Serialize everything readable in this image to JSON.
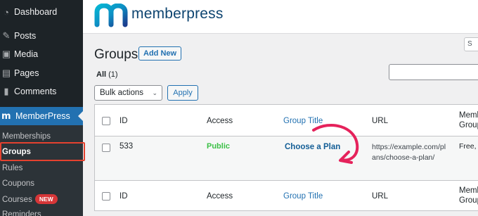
{
  "sidebar": {
    "items": [
      {
        "label": "Dashboard",
        "icon": "dashboard-icon"
      },
      {
        "label": "Posts",
        "icon": "pin-icon"
      },
      {
        "label": "Media",
        "icon": "media-icon"
      },
      {
        "label": "Pages",
        "icon": "pages-icon"
      },
      {
        "label": "Comments",
        "icon": "comment-icon"
      }
    ],
    "active": {
      "label": "MemberPress",
      "icon": "memberpress-icon"
    },
    "submenu": [
      {
        "label": "Memberships"
      },
      {
        "label": "Groups"
      },
      {
        "label": "Rules"
      },
      {
        "label": "Coupons"
      },
      {
        "label": "Courses",
        "badge": "NEW"
      },
      {
        "label": "Reminders"
      }
    ]
  },
  "header": {
    "logo_text": "memberpress",
    "screen_options_label": "S"
  },
  "page": {
    "title": "Groups",
    "add_new_label": "Add New",
    "filter_all_label": "All",
    "filter_all_count": "(1)",
    "bulk_actions_label": "Bulk actions",
    "apply_label": "Apply"
  },
  "table": {
    "columns": [
      "ID",
      "Access",
      "Group Title",
      "URL",
      "Memb Group"
    ],
    "column_line2": "Group",
    "column_line1": "Memb",
    "row": {
      "id": "533",
      "access": "Public",
      "title": "Choose a Plan",
      "url_line1": "https://example.com/pl",
      "url_line2": "ans/choose-a-plan/",
      "memberships": "Free,"
    }
  },
  "colors": {
    "sidebar_bg": "#1d2327",
    "accent": "#2271b1",
    "highlight_box": "#e4412f",
    "annotation_arrow": "#e5225b",
    "public_green": "#3bc046"
  }
}
